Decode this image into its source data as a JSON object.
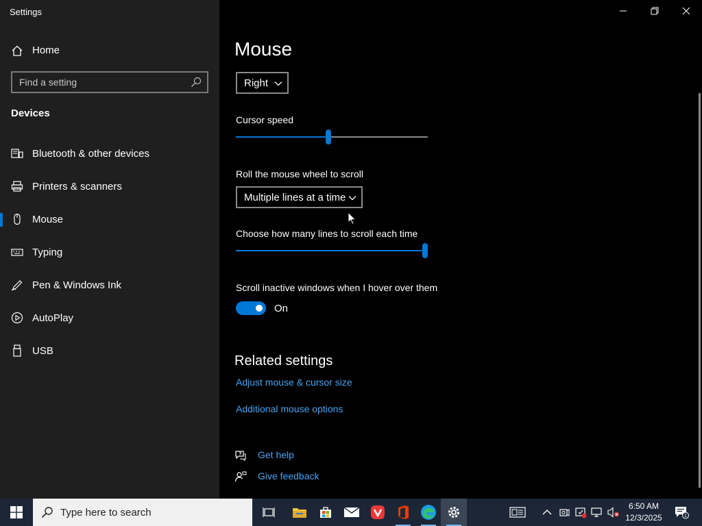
{
  "window": {
    "app_title": "Settings"
  },
  "sidebar": {
    "home_label": "Home",
    "search_placeholder": "Find a setting",
    "section_title": "Devices",
    "items": [
      {
        "label": "Bluetooth & other devices",
        "icon": "bluetooth-devices-icon"
      },
      {
        "label": "Printers & scanners",
        "icon": "printer-icon"
      },
      {
        "label": "Mouse",
        "icon": "mouse-icon",
        "selected": true
      },
      {
        "label": "Typing",
        "icon": "keyboard-icon"
      },
      {
        "label": "Pen & Windows Ink",
        "icon": "pen-icon"
      },
      {
        "label": "AutoPlay",
        "icon": "autoplay-icon"
      },
      {
        "label": "USB",
        "icon": "usb-icon"
      }
    ]
  },
  "main": {
    "page_title": "Mouse",
    "primary_button": {
      "value": "Right"
    },
    "cursor_speed": {
      "label": "Cursor speed",
      "value_fraction": 0.48
    },
    "wheel_scroll": {
      "label": "Roll the mouse wheel to scroll",
      "value": "Multiple lines at a time"
    },
    "lines_to_scroll": {
      "label": "Choose how many lines to scroll each time",
      "value_fraction": 1.0
    },
    "scroll_inactive": {
      "label": "Scroll inactive windows when I hover over them",
      "state_label": "On"
    },
    "related": {
      "title": "Related settings",
      "links": [
        "Adjust mouse & cursor size",
        "Additional mouse options"
      ]
    },
    "help": {
      "get_help": "Get help",
      "give_feedback": "Give feedback"
    }
  },
  "taskbar": {
    "search_placeholder": "Type here to search",
    "clock_time": "6:50 AM",
    "clock_date": "12/3/2025",
    "notification_count": "1"
  },
  "colors": {
    "accent": "#0078d7",
    "link": "#4aa3f0",
    "sidebar_bg": "#1f1f1f",
    "taskbar_bg": "#1c2636"
  }
}
